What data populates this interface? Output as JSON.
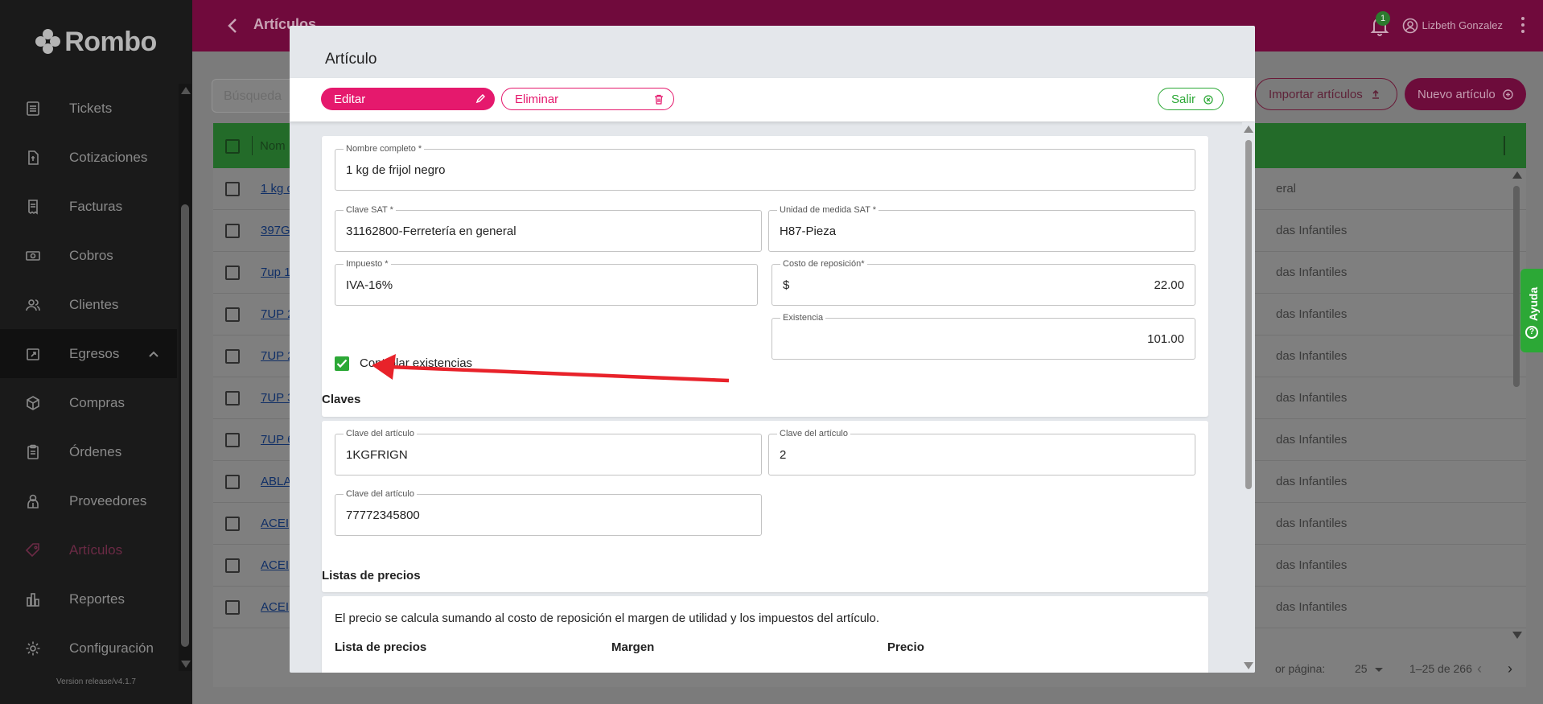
{
  "sidebar": {
    "logo": "Rombo",
    "items": [
      {
        "label": "Tickets",
        "icon": "tickets-icon"
      },
      {
        "label": "Cotizaciones",
        "icon": "quote-document-icon"
      },
      {
        "label": "Facturas",
        "icon": "invoice-icon"
      },
      {
        "label": "Cobros",
        "icon": "cash-icon"
      },
      {
        "label": "Clientes",
        "icon": "people-icon"
      },
      {
        "label": "Egresos",
        "icon": "expenses-icon"
      },
      {
        "label": "Compras",
        "icon": "box-icon"
      },
      {
        "label": "Órdenes",
        "icon": "clipboard-icon"
      },
      {
        "label": "Proveedores",
        "icon": "supplier-icon"
      },
      {
        "label": "Artículos",
        "icon": "tag-icon"
      },
      {
        "label": "Reportes",
        "icon": "bar-chart-icon"
      },
      {
        "label": "Configuración",
        "icon": "gear-icon"
      }
    ],
    "version": "Version release/v4.1.7"
  },
  "header": {
    "title": "Artículos",
    "notification_count": "1",
    "user_name": "Lizbeth Gonzalez"
  },
  "list_page": {
    "search_placeholder": "Búsqueda",
    "import_label": "Importar artículos",
    "new_label": "Nuevo artículo",
    "column_name": "Nom",
    "rows": [
      {
        "name": "1 kg d",
        "category": "eral"
      },
      {
        "name": "397G",
        "category": "das Infantiles"
      },
      {
        "name": "7up 1",
        "category": "das Infantiles"
      },
      {
        "name": "7UP 2",
        "category": "das Infantiles"
      },
      {
        "name": "7UP 2",
        "category": "das Infantiles"
      },
      {
        "name": "7UP 3",
        "category": "das Infantiles"
      },
      {
        "name": "7UP 6",
        "category": "das Infantiles"
      },
      {
        "name": "ABLA",
        "category": "das Infantiles"
      },
      {
        "name": "ACEI",
        "category": "das Infantiles"
      },
      {
        "name": "ACEI",
        "category": "das Infantiles"
      },
      {
        "name": "ACEI",
        "category": "das Infantiles"
      }
    ],
    "pager": {
      "label": "or página:",
      "per_page": "25",
      "range": "1–25 de 266"
    }
  },
  "help_tab": "Ayuda",
  "modal": {
    "title": "Artículo",
    "edit_label": "Editar",
    "delete_label": "Eliminar",
    "exit_label": "Salir",
    "general": {
      "full_name": {
        "label": "Nombre completo *",
        "value": "1 kg de frijol negro"
      },
      "sat_key": {
        "label": "Clave SAT *",
        "value": "31162800-Ferretería en general"
      },
      "sat_unit": {
        "label": "Unidad de medida SAT *",
        "value": "H87-Pieza"
      },
      "tax": {
        "label": "Impuesto *",
        "value": "IVA-16%"
      },
      "cost": {
        "label": "Costo de reposición*",
        "prefix": "$",
        "value": "22.00"
      },
      "stock_control_label": "Controlar existencias",
      "stock_control_checked": true,
      "stock": {
        "label": "Existencia",
        "value": "101.00"
      }
    },
    "keys_title": "Claves",
    "keys": [
      {
        "label": "Clave del artículo",
        "value": "1KGFRIGN"
      },
      {
        "label": "Clave del artículo",
        "value": "2"
      },
      {
        "label": "Clave del artículo",
        "value": "77772345800"
      }
    ],
    "prices_title": "Listas de precios",
    "prices_info": "El precio se calcula sumando al costo de reposición el margen de utilidad y los impuestos del artículo.",
    "price_columns": [
      "Lista de precios",
      "Margen",
      "Precio"
    ]
  },
  "colors": {
    "primary": "#e5196d",
    "success": "#2ca836",
    "topbar": "#700a3c",
    "annotation": "#e8222a"
  }
}
